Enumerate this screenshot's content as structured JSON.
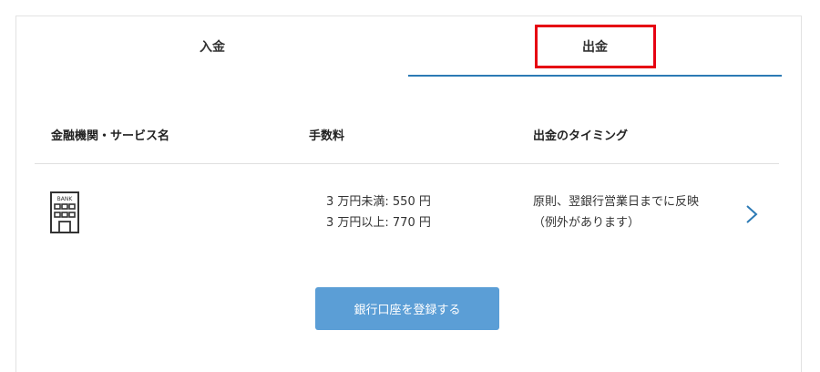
{
  "tabs": {
    "deposit_label": "入金",
    "withdraw_label": "出金"
  },
  "table": {
    "headers": {
      "name": "金融機関・サービス名",
      "fee": "手数料",
      "timing": "出金のタイミング"
    },
    "row": {
      "icon": "bank-building-icon",
      "icon_text": "BANK",
      "fee_line1": "3 万円未満: 550 円",
      "fee_line2": "3 万円以上: 770 円",
      "timing_line1": "原則、翌銀行営業日までに反映",
      "timing_line2": "（例外があります）"
    }
  },
  "register_button_label": "銀行口座を登録する",
  "colors": {
    "accent": "#2c7ab5",
    "button": "#5b9ed6",
    "highlight": "#e60012"
  }
}
